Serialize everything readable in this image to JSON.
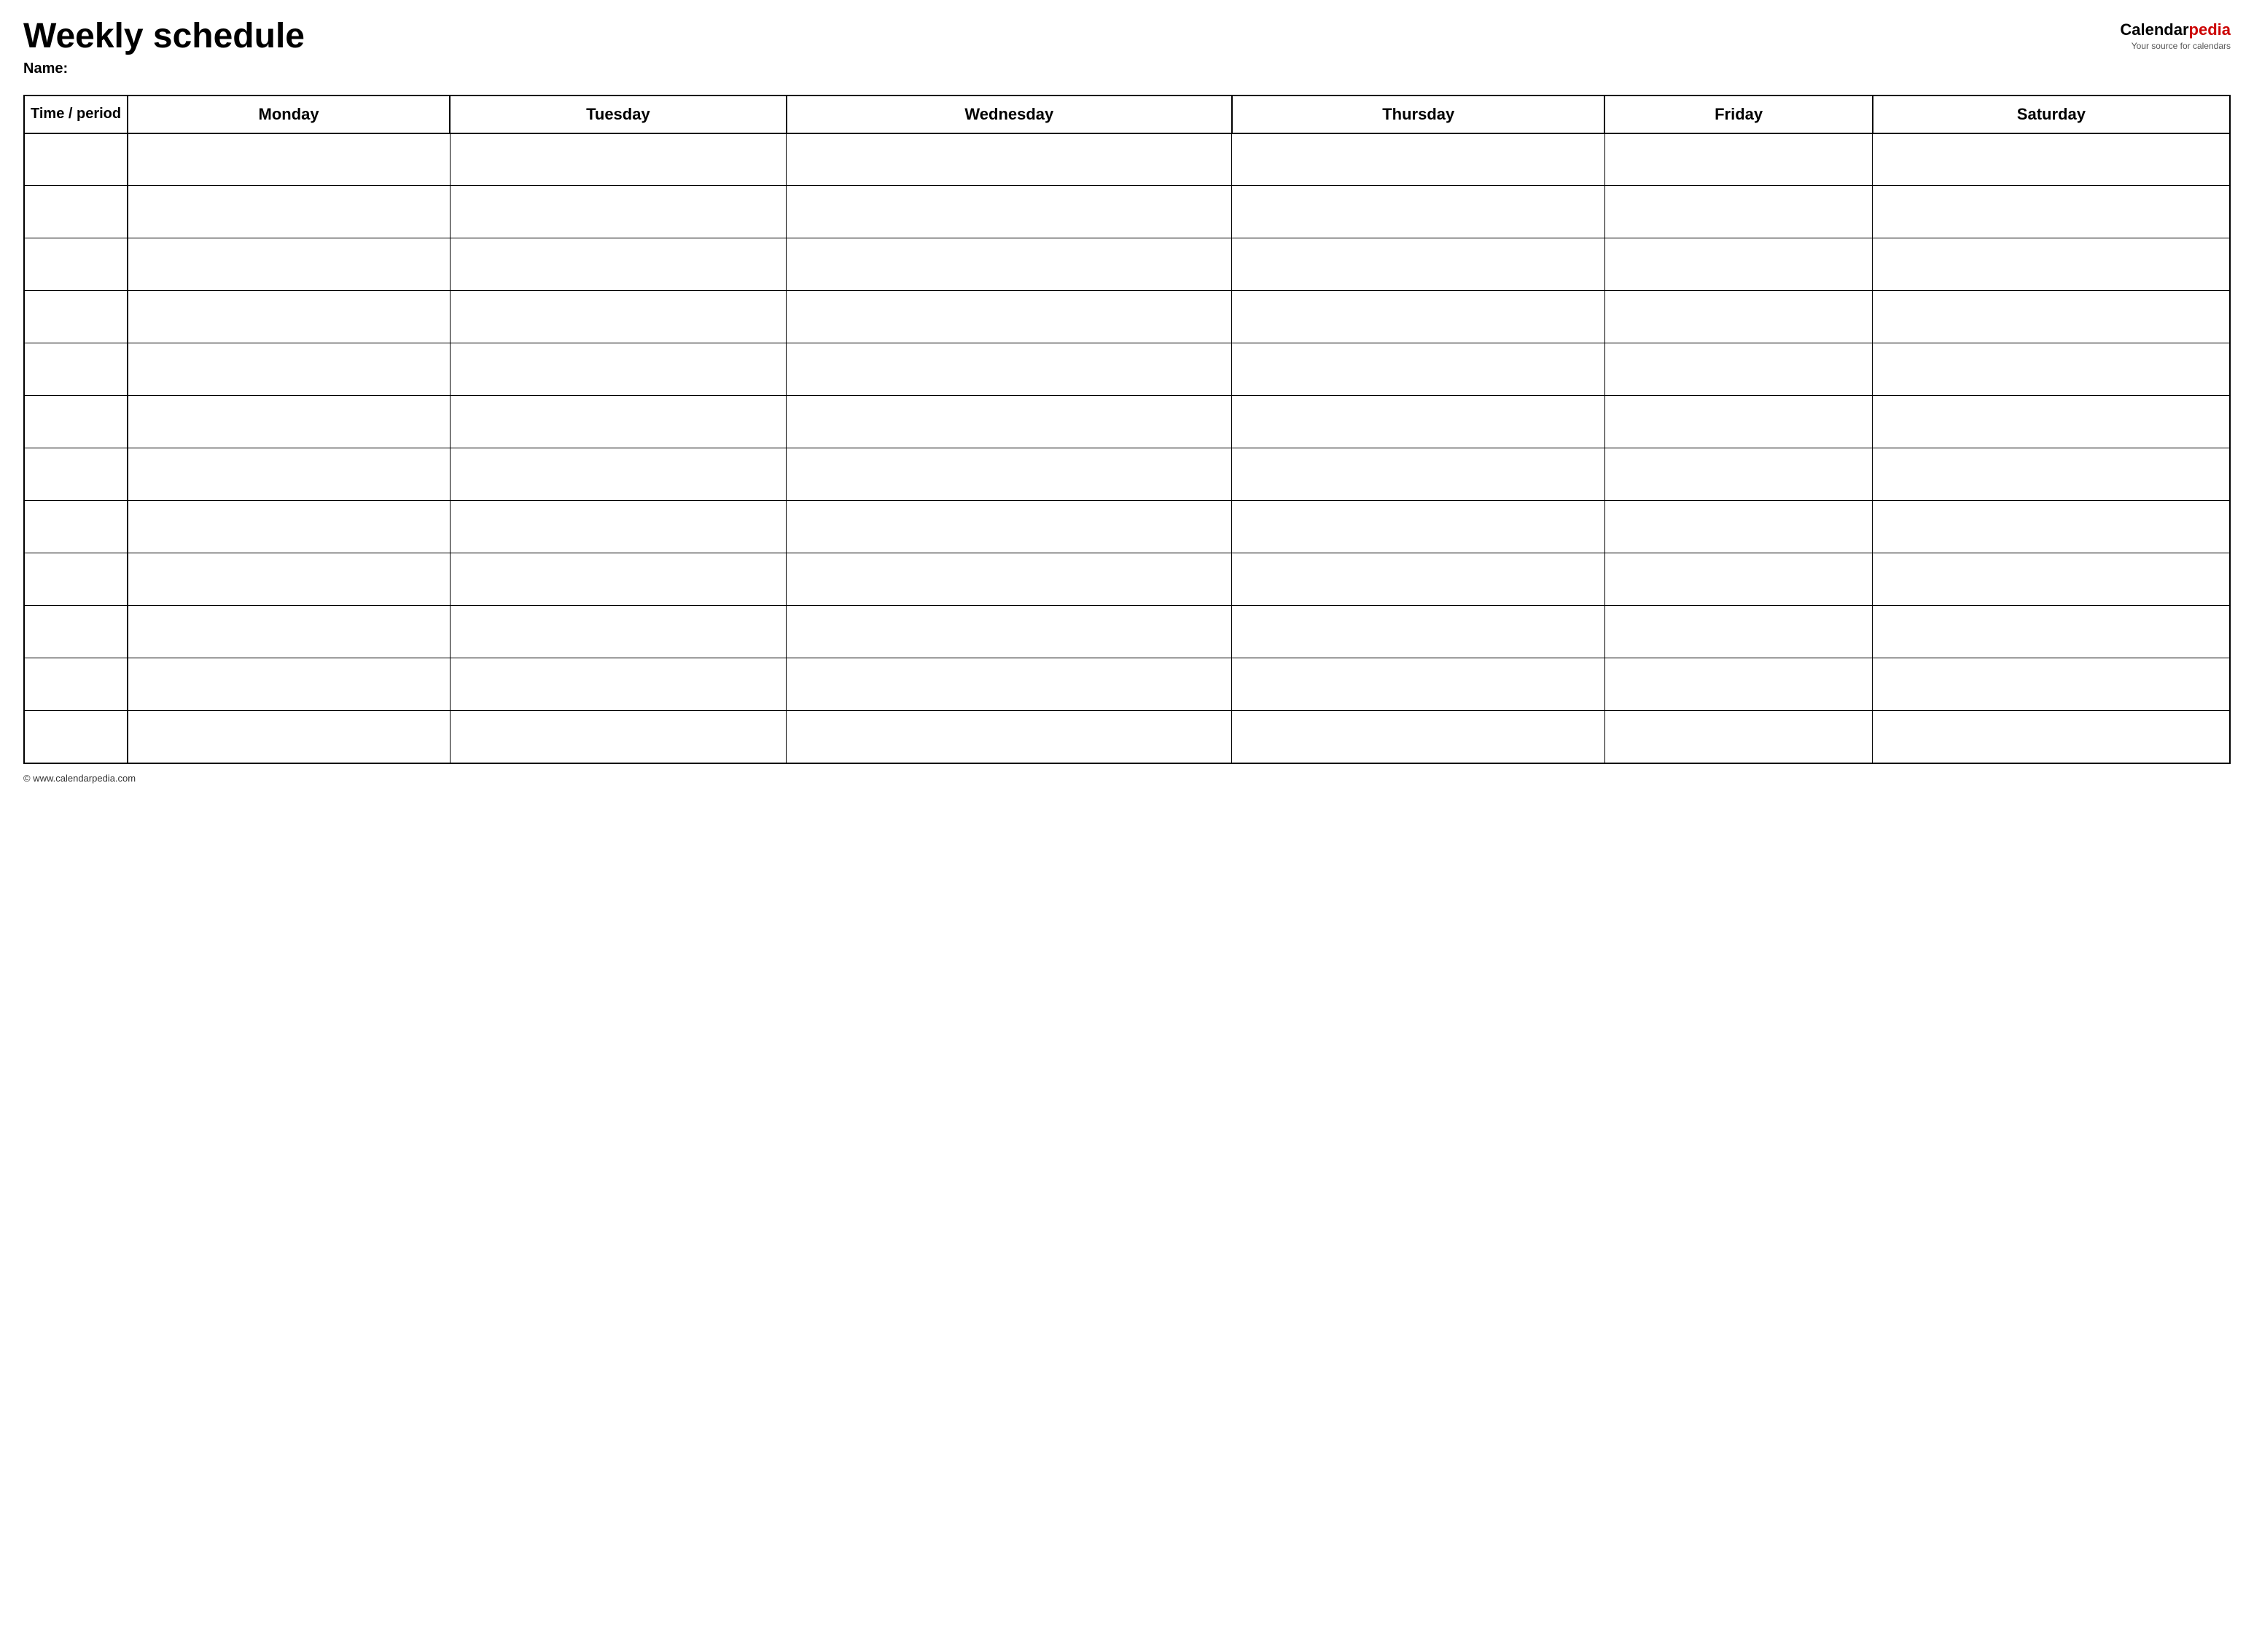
{
  "header": {
    "title": "Weekly schedule",
    "name_label": "Name:",
    "logo": {
      "calendar_text": "Calendar",
      "pedia_text": "pedia",
      "tagline": "Your source for calendars"
    }
  },
  "table": {
    "columns": [
      "Time / period",
      "Monday",
      "Tuesday",
      "Wednesday",
      "Thursday",
      "Friday",
      "Saturday"
    ],
    "row_count": 12
  },
  "footer": {
    "url": "© www.calendarpedia.com"
  }
}
